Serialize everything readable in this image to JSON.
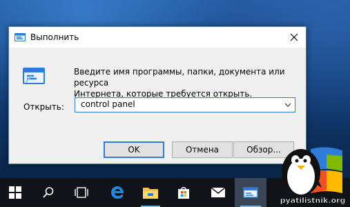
{
  "dialog": {
    "title": "Выполнить",
    "description_line1": "Введите имя программы, папки, документа или ресурса",
    "description_line2": "Интернета, которые требуется открыть.",
    "open_label": "Открыть:",
    "open_value": "control panel",
    "ok_label": "OK",
    "cancel_label": "Отмена",
    "browse_label": "Обзор..."
  },
  "taskbar": {
    "items": [
      {
        "icon": "windows-start-icon"
      },
      {
        "icon": "search-icon"
      },
      {
        "icon": "task-view-icon"
      },
      {
        "icon": "edge-icon"
      },
      {
        "icon": "file-explorer-icon"
      },
      {
        "icon": "store-icon"
      },
      {
        "icon": "mail-icon"
      },
      {
        "icon": "run-icon",
        "active": true
      }
    ]
  },
  "watermark": {
    "text": "pyatilistnik.org"
  },
  "colors": {
    "accent": "#2f7bd8",
    "taskbar": "#101418",
    "dialog_bg": "#f0f0f0"
  }
}
